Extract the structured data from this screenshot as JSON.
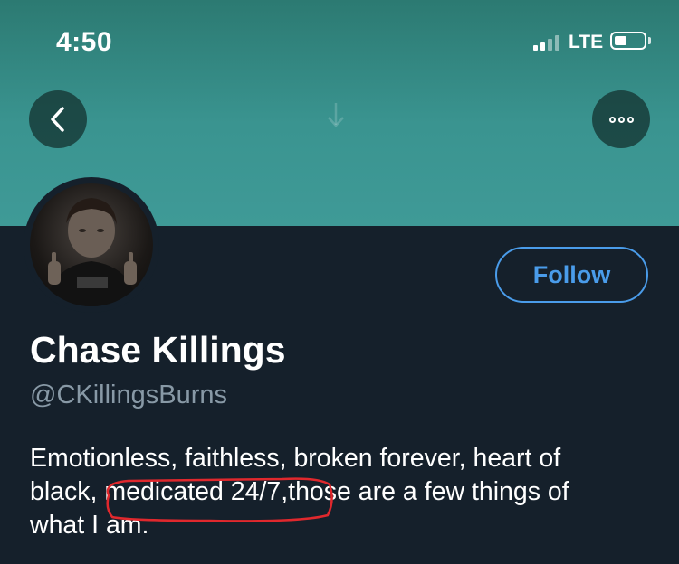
{
  "status_bar": {
    "time": "4:50",
    "network": "LTE"
  },
  "header": {
    "back_icon": "chevron-left-icon",
    "more_icon": "more-dots-icon",
    "banner_color": "#3f9a97"
  },
  "profile": {
    "display_name": "Chase Killings",
    "handle": "@CKillingsBurns",
    "follow_label": "Follow",
    "bio_lines": [
      "Emotionless, faithless, broken forever, heart of",
      "black, medicated 24/7,those are a few things of",
      "what I am."
    ]
  },
  "colors": {
    "background": "#15202b",
    "accent": "#4a9cea",
    "secondary_text": "#8899a6",
    "annotation": "#e0282d"
  }
}
